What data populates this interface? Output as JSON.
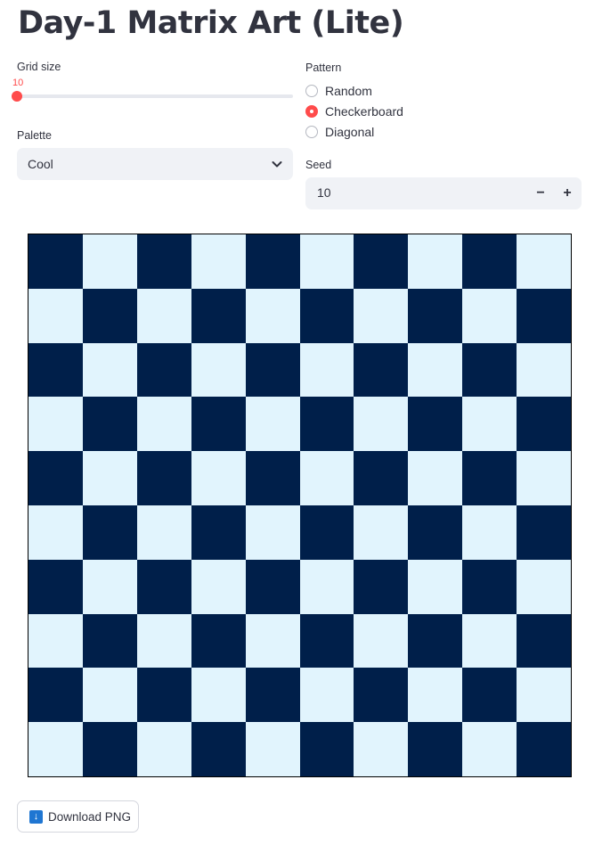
{
  "title": "Day-1 Matrix Art (Lite)",
  "grid_size": {
    "label": "Grid size",
    "value": "10",
    "min_fraction": 0.0
  },
  "palette": {
    "label": "Palette",
    "selected": "Cool"
  },
  "pattern": {
    "label": "Pattern",
    "options": [
      {
        "label": "Random",
        "selected": false
      },
      {
        "label": "Checkerboard",
        "selected": true
      },
      {
        "label": "Diagonal",
        "selected": false
      }
    ]
  },
  "seed": {
    "label": "Seed",
    "value": "10",
    "minus": "−",
    "plus": "+"
  },
  "board": {
    "rows": 10,
    "cols": 10,
    "dark_color": "#001f4a",
    "light_color": "#e1f4fd"
  },
  "download": {
    "label": "Download PNG",
    "icon": "download-icon"
  },
  "colors": {
    "accent": "#ff4b4b",
    "input_bg": "#f0f2f6"
  }
}
